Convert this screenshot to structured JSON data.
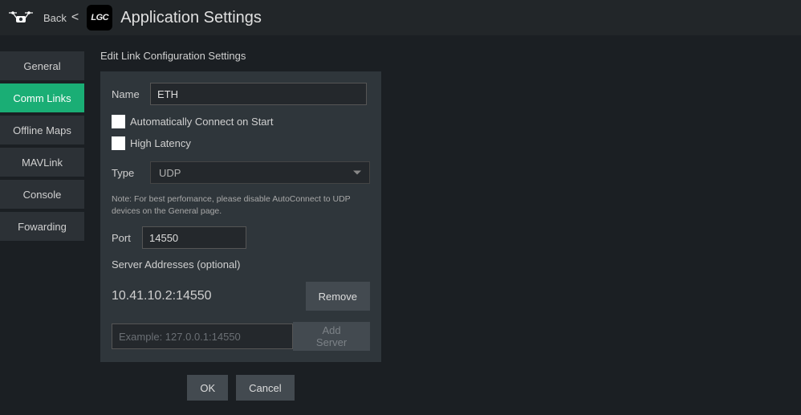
{
  "header": {
    "back_label": "Back",
    "logo_text": "LGC",
    "title": "Application Settings"
  },
  "sidebar": {
    "items": [
      {
        "label": "General"
      },
      {
        "label": "Comm Links"
      },
      {
        "label": "Offline Maps"
      },
      {
        "label": "MAVLink"
      },
      {
        "label": "Console"
      },
      {
        "label": "Fowarding"
      }
    ],
    "active_index": 1
  },
  "form": {
    "section_title": "Edit Link Configuration Settings",
    "name_label": "Name",
    "name_value": "ETH",
    "auto_connect_label": "Automatically Connect on Start",
    "high_latency_label": "High Latency",
    "type_label": "Type",
    "type_value": "UDP",
    "note_text": "Note: For best perfomance, please disable AutoConnect to UDP devices on the General page.",
    "port_label": "Port",
    "port_value": "14550",
    "server_addresses_label": "Server Addresses (optional)",
    "server_address_0": "10.41.10.2:14550",
    "remove_label": "Remove",
    "example_placeholder": "Example: 127.0.0.1:14550",
    "addserver_label": "Add Server",
    "ok_label": "OK",
    "cancel_label": "Cancel"
  }
}
